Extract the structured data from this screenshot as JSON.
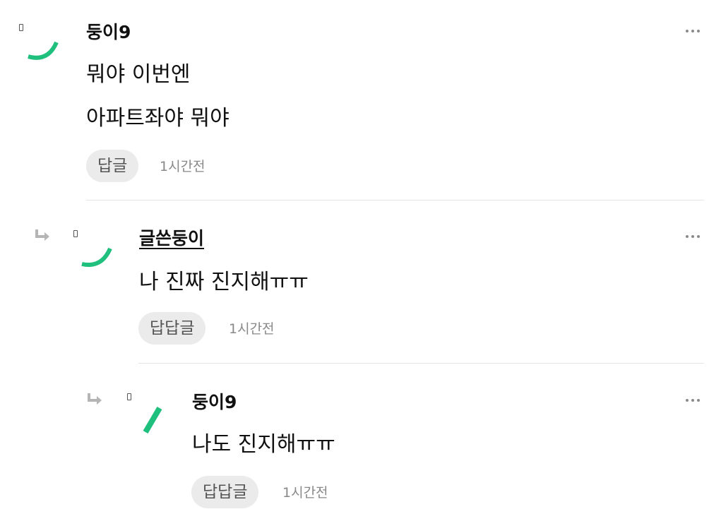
{
  "comments": [
    {
      "author": "둥이9",
      "lines": [
        "뭐야 이번엔",
        "아파트좌야 뭐야"
      ],
      "reply_label": "답글",
      "time": "1시간전",
      "avatar_icon": "avatar-arc-icon",
      "more_icon": "more-options-icon"
    },
    {
      "author": "글쓴둥이",
      "lines": [
        "나 진짜 진지해ㅠㅠ"
      ],
      "reply_label": "답답글",
      "time": "1시간전",
      "avatar_icon": "avatar-arc-icon",
      "more_icon": "more-options-icon",
      "is_reply": true
    },
    {
      "author": "둥이9",
      "lines": [
        "나도 진지해ㅠㅠ"
      ],
      "reply_label": "답답글",
      "time": "1시간전",
      "avatar_icon": "avatar-slash-icon",
      "more_icon": "more-options-icon",
      "is_reply": true
    }
  ],
  "colors": {
    "accent": "#1fbf7d",
    "reply_button_bg": "#ebebeb",
    "muted_text": "#888888"
  }
}
